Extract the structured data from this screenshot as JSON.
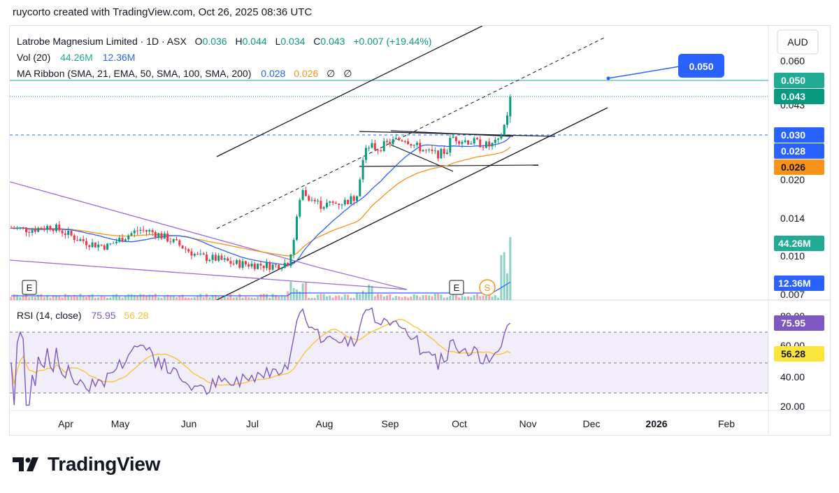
{
  "header": {
    "text": "ruycorto created with TradingView.com, Oct 26, 2025 08:36 UTC"
  },
  "legend": {
    "symbol": "Latrobe Magnesium Limited · 1D · ASX",
    "ohlc": [
      {
        "k": "O",
        "v": "0.036"
      },
      {
        "k": "H",
        "v": "0.044"
      },
      {
        "k": "L",
        "v": "0.034"
      },
      {
        "k": "C",
        "v": "0.043"
      }
    ],
    "change": "+0.007 (+19.44%)",
    "vol_label": "Vol (20)",
    "vol_values": [
      "44.26M",
      "12.36M"
    ],
    "ma_label": "MA Ribbon (SMA, 21, EMA, 50, SMA, 100, SMA, 200)",
    "ma_values": [
      "0.028",
      "0.026",
      "∅",
      "∅"
    ],
    "rsi_label": "RSI (14, close)",
    "rsi_values": [
      "75.95",
      "56.28"
    ]
  },
  "currency": "AUD",
  "price_axis": [
    "0.060",
    "0.050",
    "0.043",
    "0.030",
    "0.028",
    "0.026",
    "0.020",
    "0.014",
    "0.010",
    "0.007"
  ],
  "price_badges": [
    {
      "text": "0.050",
      "color": "#22ab94"
    },
    {
      "text": "0.043",
      "color": "#089981"
    },
    {
      "text": "0.030",
      "color": "#2962ff"
    },
    {
      "text": "0.028",
      "color": "#2962ff"
    },
    {
      "text": "0.026",
      "color": "#f7931a"
    },
    {
      "text": "44.26M",
      "color": "#22ab94"
    },
    {
      "text": "12.36M",
      "color": "#2962ff"
    }
  ],
  "rsi_axis": [
    "80.00",
    "60.00",
    "40.00",
    "20.00"
  ],
  "rsi_badges": [
    {
      "text": "75.95",
      "color": "#7e57c2"
    },
    {
      "text": "56.28",
      "color": "#fbe53b"
    }
  ],
  "callout": {
    "text": "0.050"
  },
  "event_markers": [
    "E",
    "E",
    "S"
  ],
  "time_axis": [
    "Apr",
    "May",
    "Jun",
    "Jul",
    "Aug",
    "Sep",
    "Oct",
    "Nov",
    "Dec",
    "2026",
    "Feb"
  ],
  "brand": "TradingView",
  "colors": {
    "up": "#089981",
    "down": "#f23645",
    "ma21": "#2962ff",
    "ema50": "#f7931a",
    "rsi": "#7e57c2",
    "rsi_ma": "#fbc02d",
    "wedge": "#9c6ade"
  },
  "chart_data": {
    "type": "candlestick",
    "interval": "1D",
    "y_scale": "log",
    "ylim": [
      0.007,
      0.062
    ],
    "current": {
      "open": 0.036,
      "high": 0.044,
      "low": 0.034,
      "close": 0.043
    },
    "price_series_approx": [
      {
        "x": "Apr",
        "close": 0.013
      },
      {
        "x": "May",
        "close": 0.0125
      },
      {
        "x": "Jun",
        "close": 0.011
      },
      {
        "x": "Jul",
        "close": 0.009
      },
      {
        "x": "Aug",
        "close": 0.017
      },
      {
        "x": "Sep",
        "close": 0.027
      },
      {
        "x": "Oct",
        "close": 0.028
      },
      {
        "x": "Oct 24",
        "close": 0.043
      }
    ],
    "rsi": {
      "latest": 75.95,
      "signal": 56.28,
      "levels": [
        70,
        50,
        30
      ]
    }
  }
}
